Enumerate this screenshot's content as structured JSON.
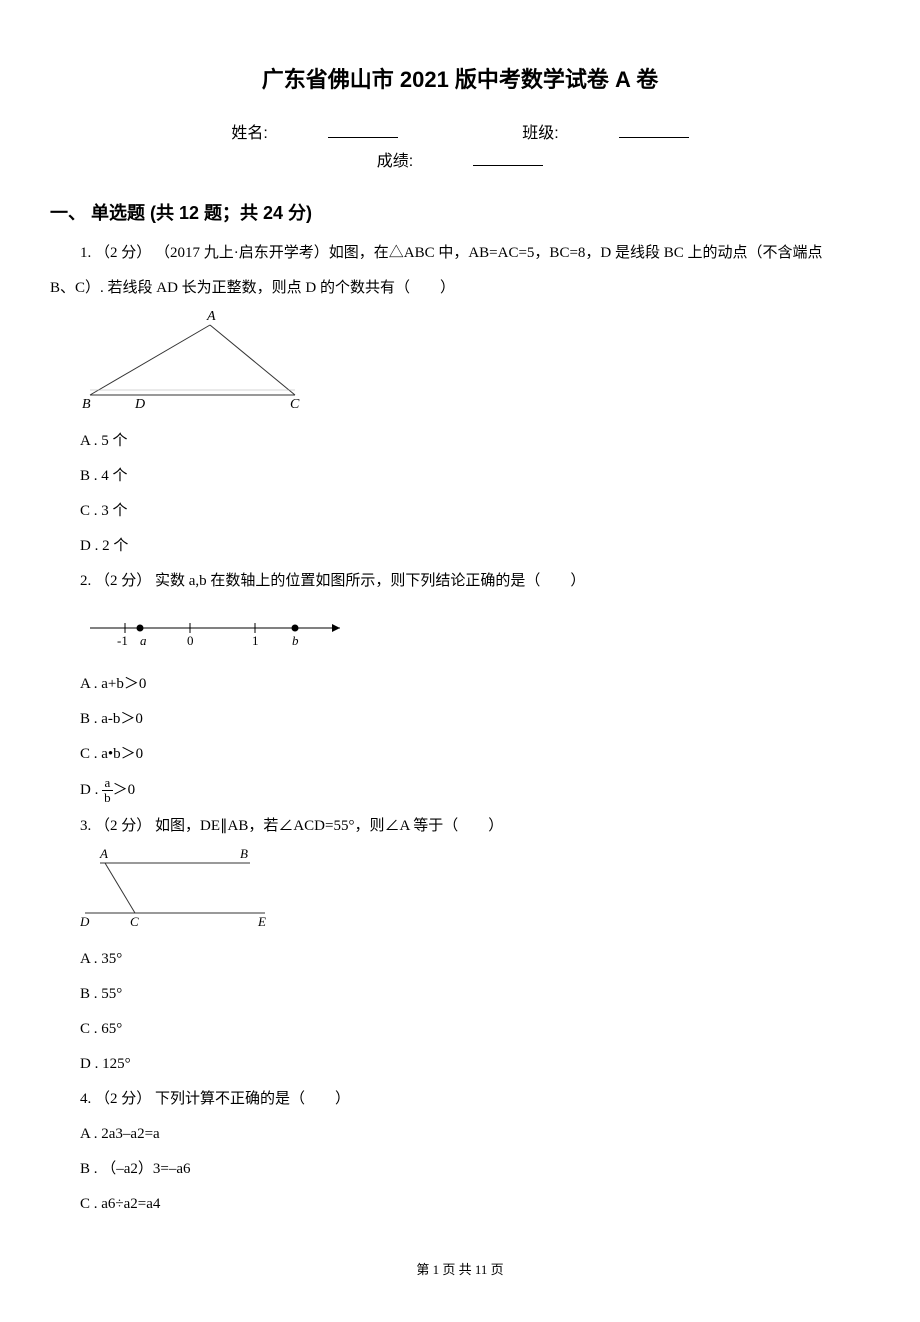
{
  "title": "广东省佛山市 2021 版中考数学试卷 A 卷",
  "info": {
    "name_label": "姓名:",
    "class_label": "班级:",
    "score_label": "成绩:"
  },
  "section1": {
    "header": "一、 单选题 (共 12 题；共 24 分)"
  },
  "q1": {
    "stem_a": "1.  （2 分） （2017 九上·启东开学考）如图，在△ABC 中，AB=AC=5，BC=8，D 是线段 BC 上的动点（不含端点",
    "stem_b": "B、C）. 若线段 AD 长为正整数，则点 D 的个数共有（　　）",
    "optA": "A . 5 个",
    "optB": "B . 4 个",
    "optC": "C . 3 个",
    "optD": "D . 2 个"
  },
  "q2": {
    "stem": "2.  （2 分） 实数 a,b 在数轴上的位置如图所示，则下列结论正确的是（　　）",
    "optA": "A . a+b＞0",
    "optB": "B . a-b＞0",
    "optC": "C . a•b＞0",
    "optD_prefix": "D . ",
    "optD_num": "a",
    "optD_den": "b",
    "optD_suffix": "＞0"
  },
  "q3": {
    "stem": "3.  （2 分） 如图，DE∥AB，若∠ACD=55°，则∠A 等于（　　）",
    "optA": "A . 35°",
    "optB": "B . 55°",
    "optC": "C . 65°",
    "optD": "D . 125°"
  },
  "q4": {
    "stem": "4.  （2 分） 下列计算不正确的是（　　）",
    "optA": "A . 2a3–a2=a",
    "optB": "B . （–a2）3=–a6",
    "optC": "C . a6÷a2=a4"
  },
  "footer": "第 1 页 共 11 页"
}
